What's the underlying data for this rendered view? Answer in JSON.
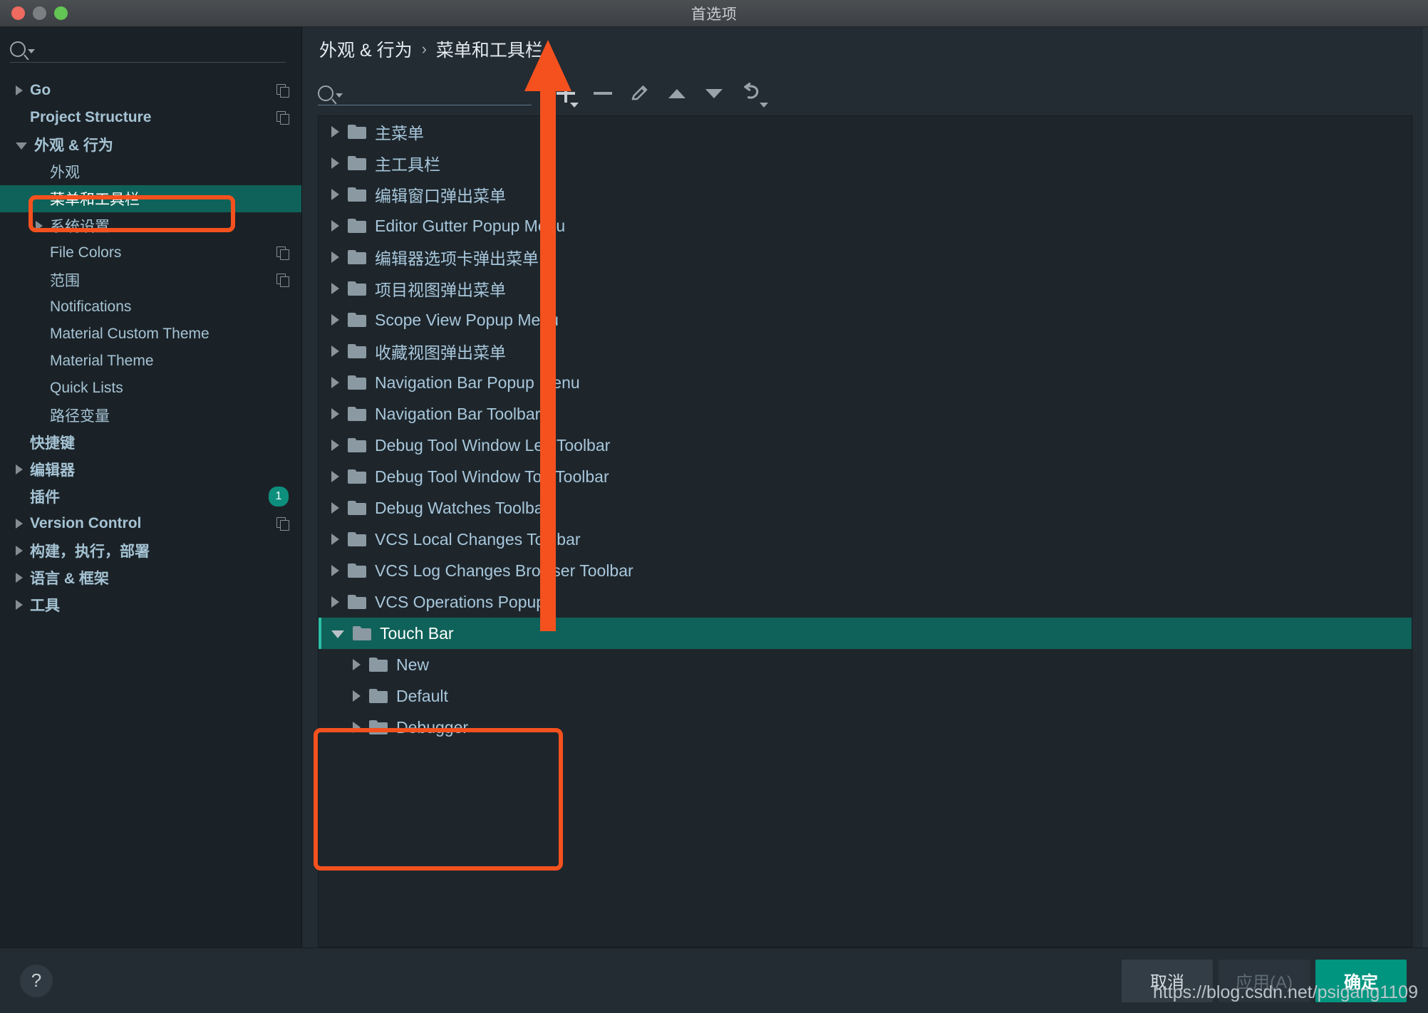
{
  "window": {
    "title": "首选项",
    "traffic_lights": [
      "close",
      "minimize",
      "zoom"
    ]
  },
  "sidebar": {
    "search_placeholder": "",
    "search_value": "",
    "items": [
      {
        "label": "Go",
        "indent": 0,
        "arrow": "collapsed",
        "bold": true,
        "copy_icon": true,
        "badge": null,
        "selected": false
      },
      {
        "label": "Project Structure",
        "indent": 0,
        "arrow": "none",
        "bold": true,
        "copy_icon": true,
        "badge": null,
        "selected": false
      },
      {
        "label": "外观 & 行为",
        "indent": 0,
        "arrow": "expanded",
        "bold": true,
        "copy_icon": false,
        "badge": null,
        "selected": false
      },
      {
        "label": "外观",
        "indent": 1,
        "arrow": "none",
        "bold": false,
        "copy_icon": false,
        "badge": null,
        "selected": false
      },
      {
        "label": "菜单和工具栏",
        "indent": 1,
        "arrow": "none",
        "bold": false,
        "copy_icon": false,
        "badge": null,
        "selected": true
      },
      {
        "label": "系统设置",
        "indent": 1,
        "arrow": "collapsed",
        "bold": false,
        "copy_icon": false,
        "badge": null,
        "selected": false
      },
      {
        "label": "File Colors",
        "indent": 1,
        "arrow": "none",
        "bold": false,
        "copy_icon": true,
        "badge": null,
        "selected": false
      },
      {
        "label": "范围",
        "indent": 1,
        "arrow": "none",
        "bold": false,
        "copy_icon": true,
        "badge": null,
        "selected": false
      },
      {
        "label": "Notifications",
        "indent": 1,
        "arrow": "none",
        "bold": false,
        "copy_icon": false,
        "badge": null,
        "selected": false
      },
      {
        "label": "Material Custom Theme",
        "indent": 1,
        "arrow": "none",
        "bold": false,
        "copy_icon": false,
        "badge": null,
        "selected": false
      },
      {
        "label": "Material Theme",
        "indent": 1,
        "arrow": "none",
        "bold": false,
        "copy_icon": false,
        "badge": null,
        "selected": false
      },
      {
        "label": "Quick Lists",
        "indent": 1,
        "arrow": "none",
        "bold": false,
        "copy_icon": false,
        "badge": null,
        "selected": false
      },
      {
        "label": "路径变量",
        "indent": 1,
        "arrow": "none",
        "bold": false,
        "copy_icon": false,
        "badge": null,
        "selected": false
      },
      {
        "label": "快捷键",
        "indent": 0,
        "arrow": "none",
        "bold": true,
        "copy_icon": false,
        "badge": null,
        "selected": false
      },
      {
        "label": "编辑器",
        "indent": 0,
        "arrow": "collapsed",
        "bold": true,
        "copy_icon": false,
        "badge": null,
        "selected": false
      },
      {
        "label": "插件",
        "indent": 0,
        "arrow": "none",
        "bold": true,
        "copy_icon": false,
        "badge": "1",
        "selected": false
      },
      {
        "label": "Version Control",
        "indent": 0,
        "arrow": "collapsed",
        "bold": true,
        "copy_icon": true,
        "badge": null,
        "selected": false
      },
      {
        "label": "构建，执行，部署",
        "indent": 0,
        "arrow": "collapsed",
        "bold": true,
        "copy_icon": false,
        "badge": null,
        "selected": false
      },
      {
        "label": "语言 & 框架",
        "indent": 0,
        "arrow": "collapsed",
        "bold": true,
        "copy_icon": false,
        "badge": null,
        "selected": false
      },
      {
        "label": "工具",
        "indent": 0,
        "arrow": "collapsed",
        "bold": true,
        "copy_icon": false,
        "badge": null,
        "selected": false
      }
    ]
  },
  "main": {
    "breadcrumb": {
      "parent": "外观 & 行为",
      "separator": "›",
      "current": "菜单和工具栏"
    },
    "toolbar": {
      "filter_value": "",
      "filter_placeholder": "",
      "buttons": [
        {
          "name": "add-button",
          "icon": "plus-icon",
          "has_dropdown": true
        },
        {
          "name": "remove-button",
          "icon": "minus-icon",
          "has_dropdown": false
        },
        {
          "name": "edit-button",
          "icon": "pencil-icon",
          "has_dropdown": false
        },
        {
          "name": "move-up-button",
          "icon": "arrow-up-icon",
          "has_dropdown": false
        },
        {
          "name": "move-down-button",
          "icon": "arrow-down-icon",
          "has_dropdown": false
        },
        {
          "name": "restore-button",
          "icon": "revert-icon",
          "has_dropdown": true
        }
      ]
    },
    "tree": [
      {
        "label": "主菜单",
        "level": 1,
        "arrow": "collapsed",
        "selected": false
      },
      {
        "label": "主工具栏",
        "level": 1,
        "arrow": "collapsed",
        "selected": false
      },
      {
        "label": "编辑窗口弹出菜单",
        "level": 1,
        "arrow": "collapsed",
        "selected": false
      },
      {
        "label": "Editor Gutter Popup Menu",
        "level": 1,
        "arrow": "collapsed",
        "selected": false
      },
      {
        "label": "编辑器选项卡弹出菜单",
        "level": 1,
        "arrow": "collapsed",
        "selected": false
      },
      {
        "label": "项目视图弹出菜单",
        "level": 1,
        "arrow": "collapsed",
        "selected": false
      },
      {
        "label": "Scope View Popup Menu",
        "level": 1,
        "arrow": "collapsed",
        "selected": false
      },
      {
        "label": "收藏视图弹出菜单",
        "level": 1,
        "arrow": "collapsed",
        "selected": false
      },
      {
        "label": "Navigation Bar Popup Menu",
        "level": 1,
        "arrow": "collapsed",
        "selected": false
      },
      {
        "label": "Navigation Bar Toolbar",
        "level": 1,
        "arrow": "collapsed",
        "selected": false
      },
      {
        "label": "Debug Tool Window Left Toolbar",
        "level": 1,
        "arrow": "collapsed",
        "selected": false
      },
      {
        "label": "Debug Tool Window Top Toolbar",
        "level": 1,
        "arrow": "collapsed",
        "selected": false
      },
      {
        "label": "Debug Watches Toolbar",
        "level": 1,
        "arrow": "collapsed",
        "selected": false
      },
      {
        "label": "VCS Local Changes Toolbar",
        "level": 1,
        "arrow": "collapsed",
        "selected": false
      },
      {
        "label": "VCS Log Changes Browser Toolbar",
        "level": 1,
        "arrow": "collapsed",
        "selected": false
      },
      {
        "label": "VCS Operations Popup",
        "level": 1,
        "arrow": "collapsed",
        "selected": false
      },
      {
        "label": "Touch Bar",
        "level": 1,
        "arrow": "expanded",
        "selected": true
      },
      {
        "label": "New",
        "level": 2,
        "arrow": "collapsed",
        "selected": false
      },
      {
        "label": "Default",
        "level": 2,
        "arrow": "collapsed",
        "selected": false
      },
      {
        "label": "Debugger",
        "level": 2,
        "arrow": "collapsed",
        "selected": false
      }
    ]
  },
  "footer": {
    "help_label": "?",
    "cancel_label": "取消",
    "apply_label": "应用(A)",
    "ok_label": "确定"
  },
  "annotations": {
    "accent_color": "#f4511e",
    "arrow_target": "add-button",
    "watermark": "https://blog.csdn.net/psigang1109"
  },
  "colors": {
    "selection_teal": "#0f6259",
    "primary_button": "#00957f",
    "badge_teal": "#0e8f7e",
    "annotation_orange": "#f4511e",
    "panel_bg": "#232b33",
    "sidebar_bg": "#1b2227",
    "list_bg": "#1e262c"
  }
}
